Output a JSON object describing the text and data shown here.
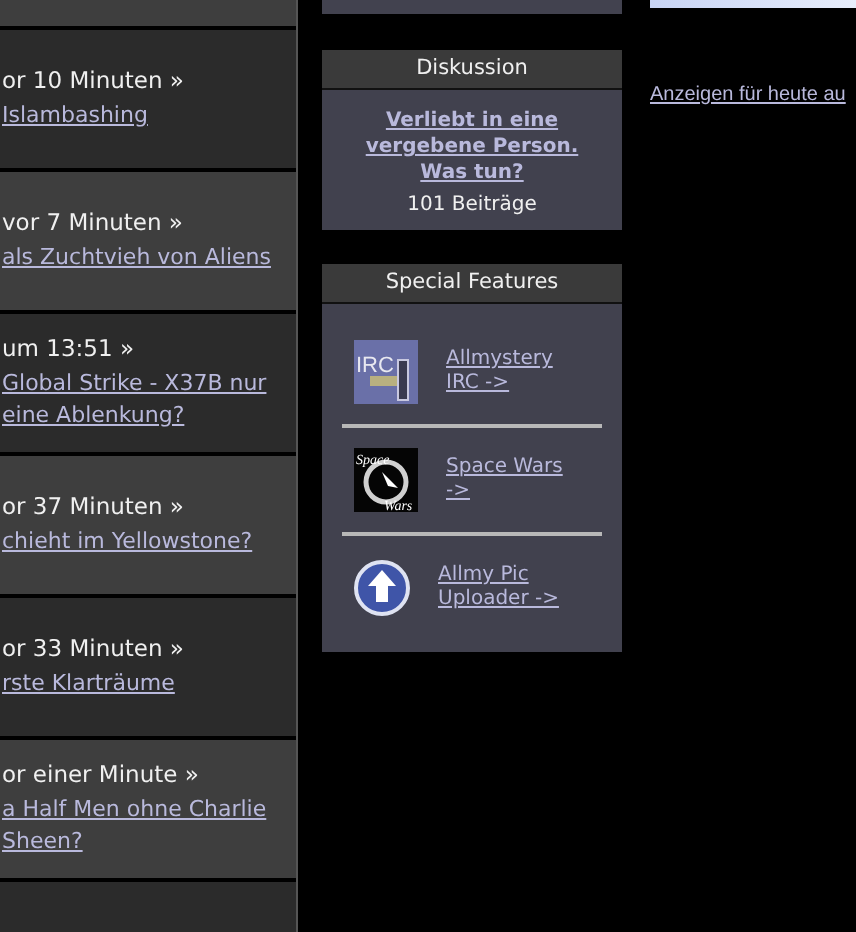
{
  "news_feed": {
    "rows": [
      {
        "time": "or 10 Minuten »",
        "link_lines": [
          "Islambashing"
        ]
      },
      {
        "time": "vor 7 Minuten »",
        "link_lines": [
          "als Zuchtvieh von Aliens"
        ]
      },
      {
        "time": "um 13:51 »",
        "link_lines": [
          "Global Strike - X37B nur",
          "eine Ablenkung?"
        ]
      },
      {
        "time": "or 37 Minuten »",
        "link_lines": [
          "chieht im Yellowstone?"
        ]
      },
      {
        "time": "or 33 Minuten »",
        "link_lines": [
          "rste Klarträume"
        ]
      },
      {
        "time": "or einer Minute »",
        "link_lines": [
          "a Half Men ohne Charlie",
          "Sheen?"
        ]
      }
    ]
  },
  "discussion": {
    "title": "Diskussion",
    "topic_lines": [
      "Verliebt in eine",
      "vergebene Person.",
      "Was tun?"
    ],
    "post_count": "101 Beiträge"
  },
  "special_features": {
    "title": "Special Features",
    "items": [
      {
        "kind": "irc",
        "icon_text": [
          "IRC"
        ],
        "label_lines": [
          "Allmystery",
          "IRC ->"
        ]
      },
      {
        "kind": "space",
        "icon_text": [
          "Space",
          "Wars"
        ],
        "label_lines": [
          "Space Wars",
          "->"
        ]
      },
      {
        "kind": "upload",
        "label_lines": [
          "Allmy Pic",
          "Uploader ->"
        ]
      }
    ]
  },
  "ads_link": "Anzeigen für heute au"
}
